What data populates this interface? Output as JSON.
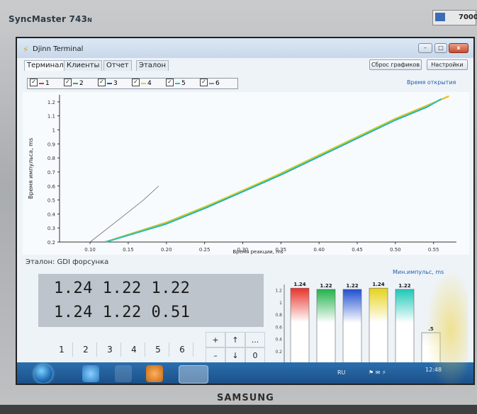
{
  "monitor": {
    "model": "SyncMaster 743",
    "model_suffix": "N",
    "brand": "SAMSUNG",
    "badge_text": "7000"
  },
  "window": {
    "title": "Djinn Terminal",
    "minimize": "–",
    "maximize": "□",
    "close": "x"
  },
  "tabs": [
    {
      "label": "Терминал",
      "active": true
    },
    {
      "label": "Клиенты",
      "active": false
    },
    {
      "label": "Отчет",
      "active": false
    },
    {
      "label": "Эталон",
      "active": false
    }
  ],
  "toolbar": {
    "reset_label": "Сброс графиков",
    "settings_label": "Настройки"
  },
  "series": [
    {
      "label": "1",
      "checked": true,
      "color": "#e8322a"
    },
    {
      "label": "2",
      "checked": true,
      "color": "#22b24c"
    },
    {
      "label": "3",
      "checked": true,
      "color": "#1f4fd0"
    },
    {
      "label": "4",
      "checked": true,
      "color": "#e6d21a"
    },
    {
      "label": "5",
      "checked": true,
      "color": "#1ec8b8"
    },
    {
      "label": "6",
      "checked": true,
      "color": "#8a8a8a"
    }
  ],
  "chart_data": {
    "type": "line",
    "title": "Время открытия",
    "xlabel": "Время реакции, ms",
    "ylabel": "Время импульса, ms",
    "xlim": [
      0.06,
      0.58
    ],
    "ylim": [
      0.2,
      1.25
    ],
    "x_ticks": [
      "0.10",
      "0.15",
      "0.20",
      "0.25",
      "0.30",
      "0.35",
      "0.40",
      "0.45",
      "0.50",
      "0.55"
    ],
    "y_ticks": [
      "0.2",
      "0.3",
      "0.4",
      "0.5",
      "0.6",
      "0.7",
      "0.8",
      "0.9",
      "1",
      "1.1",
      "1.2"
    ],
    "series": [
      {
        "color": "#e8322a",
        "x": [
          0.12,
          0.2,
          0.25,
          0.3,
          0.35,
          0.4,
          0.45,
          0.5,
          0.54,
          0.57
        ],
        "y": [
          0.2,
          0.34,
          0.44,
          0.56,
          0.68,
          0.81,
          0.94,
          1.08,
          1.17,
          1.24
        ]
      },
      {
        "color": "#22b24c",
        "x": [
          0.12,
          0.2,
          0.25,
          0.3,
          0.35,
          0.4,
          0.45,
          0.5,
          0.54,
          0.56
        ],
        "y": [
          0.2,
          0.34,
          0.45,
          0.56,
          0.69,
          0.82,
          0.95,
          1.08,
          1.16,
          1.22
        ]
      },
      {
        "color": "#1f4fd0",
        "x": [
          0.12,
          0.2,
          0.25,
          0.3,
          0.35,
          0.4,
          0.45,
          0.5,
          0.54,
          0.56
        ],
        "y": [
          0.2,
          0.33,
          0.44,
          0.56,
          0.68,
          0.81,
          0.94,
          1.07,
          1.16,
          1.22
        ]
      },
      {
        "color": "#e6d21a",
        "x": [
          0.12,
          0.2,
          0.25,
          0.3,
          0.35,
          0.4,
          0.45,
          0.5,
          0.54,
          0.57
        ],
        "y": [
          0.2,
          0.34,
          0.45,
          0.57,
          0.69,
          0.82,
          0.95,
          1.08,
          1.17,
          1.24
        ]
      },
      {
        "color": "#1ec8b8",
        "x": [
          0.12,
          0.2,
          0.25,
          0.3,
          0.35,
          0.4,
          0.45,
          0.5,
          0.54,
          0.56
        ],
        "y": [
          0.2,
          0.33,
          0.44,
          0.56,
          0.68,
          0.81,
          0.94,
          1.07,
          1.16,
          1.22
        ]
      },
      {
        "color": "#555555",
        "x": [
          0.1,
          0.14,
          0.17,
          0.19
        ],
        "y": [
          0.2,
          0.37,
          0.5,
          0.6
        ]
      }
    ],
    "grid": false
  },
  "etalon_label": "Эталон: GDI форсунка",
  "readout": {
    "row1": "1.24 1.22 1.22",
    "row2": "1.24 1.22 0.51"
  },
  "numbers": [
    "1",
    "2",
    "3",
    "4",
    "5",
    "6"
  ],
  "nav": {
    "plus": "+",
    "minus": "–",
    "up": "↑",
    "down": "↓",
    "more": "...",
    "zero": "0"
  },
  "bar_chart": {
    "type": "bar",
    "title": "Мин.импульс, ms",
    "ylim": [
      0,
      1.3
    ],
    "y_ticks": [
      "1.2",
      "1",
      "0.8",
      "0.6",
      "0.4",
      "0.2"
    ],
    "values": [
      1.24,
      1.22,
      1.22,
      1.24,
      1.22,
      0.51
    ],
    "value_labels": [
      "1.24",
      "1.22",
      "1.22",
      "1.24",
      "1.22",
      ".5"
    ],
    "colors": [
      "#e8322a",
      "#22b24c",
      "#1f4fd0",
      "#e6d21a",
      "#1ec8b8",
      "#f3f3f3"
    ]
  },
  "taskbar": {
    "lang": "RU",
    "time": "12:48"
  }
}
